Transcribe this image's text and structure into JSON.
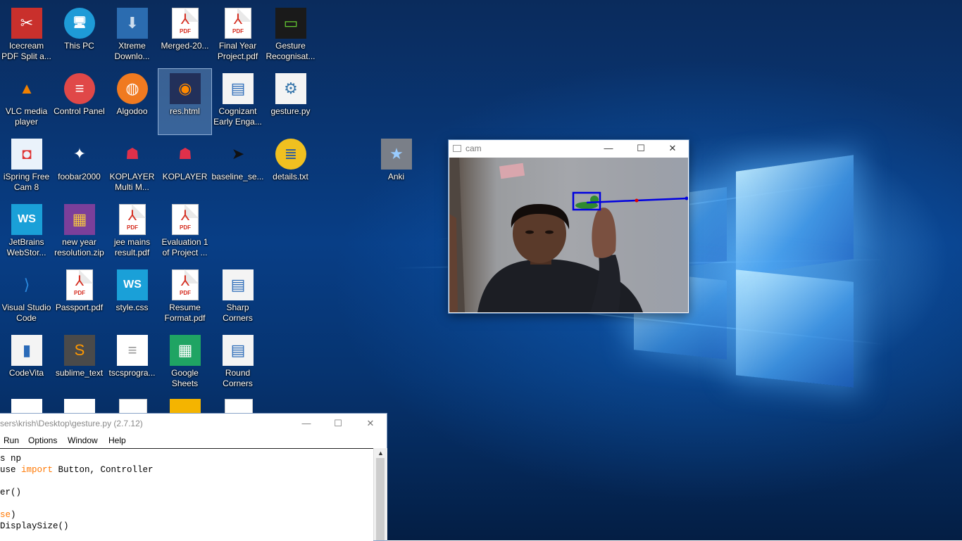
{
  "desktop": {
    "icons": [
      {
        "label": "Icecream PDF Split a...",
        "icon": "icecream-pdf-icon"
      },
      {
        "label": "This PC",
        "icon": "this-pc-icon"
      },
      {
        "label": "Xtreme Downlo...",
        "icon": "xtreme-download-icon"
      },
      {
        "label": "Merged-20...",
        "icon": "pdf-file-icon"
      },
      {
        "label": "Final Year Project.pdf",
        "icon": "pdf-file-icon"
      },
      {
        "label": "Gesture Recognisat...",
        "icon": "gesture-thumbnail-icon"
      },
      {
        "label": "VLC media player",
        "icon": "vlc-icon"
      },
      {
        "label": "Control Panel",
        "icon": "control-panel-icon"
      },
      {
        "label": "Algodoo",
        "icon": "algodoo-icon"
      },
      {
        "label": "res.html",
        "icon": "firefox-html-icon"
      },
      {
        "label": "Cognizant Early Enga...",
        "icon": "document-shortcut-icon"
      },
      {
        "label": "gesture.py",
        "icon": "python-file-icon"
      },
      {
        "label": "iSpring Free Cam 8",
        "icon": "ispring-cam-icon"
      },
      {
        "label": "foobar2000",
        "icon": "foobar-icon"
      },
      {
        "label": "KOPLAYER Multi M...",
        "icon": "koplayer-icon"
      },
      {
        "label": "KOPLAYER",
        "icon": "koplayer-icon"
      },
      {
        "label": "baseline_se...",
        "icon": "send-arrow-icon"
      },
      {
        "label": "details.txt",
        "icon": "text-file-icon"
      },
      {
        "label": "Anki",
        "icon": "anki-icon"
      },
      {
        "label": "JetBrains WebStor...",
        "icon": "webstorm-icon"
      },
      {
        "label": "new year resolution.zip",
        "icon": "winrar-icon"
      },
      {
        "label": "jee mains result.pdf",
        "icon": "pdf-file-icon"
      },
      {
        "label": "Evaluation 1 of Project ...",
        "icon": "pdf-file-icon"
      },
      {
        "label": "Visual Studio Code",
        "icon": "vscode-icon"
      },
      {
        "label": "Passport.pdf",
        "icon": "pdf-file-icon"
      },
      {
        "label": "style.css",
        "icon": "webstorm-icon"
      },
      {
        "label": "Resume Format.pdf",
        "icon": "pdf-file-icon"
      },
      {
        "label": "Sharp Corners",
        "icon": "document-shortcut-icon"
      },
      {
        "label": "CodeVita",
        "icon": "codevita-icon"
      },
      {
        "label": "sublime_text",
        "icon": "sublime-icon"
      },
      {
        "label": "tscsprogra...",
        "icon": "text-document-icon"
      },
      {
        "label": "Google Sheets",
        "icon": "google-sheets-icon"
      },
      {
        "label": "Round Corners",
        "icon": "document-shortcut-icon"
      }
    ]
  },
  "cam_window": {
    "title": "cam",
    "minimize": "—",
    "maximize": "☐",
    "close": "✕"
  },
  "idle_window": {
    "title": "sers\\krish\\Desktop\\gesture.py (2.7.12)",
    "menu": [
      "Run",
      "Options",
      "Window",
      "Help"
    ],
    "code_lines": [
      {
        "pre": "s np",
        "kw": "",
        "post": ""
      },
      {
        "pre": "use ",
        "kw": "import",
        "post": " Button, Controller"
      },
      {
        "pre": "",
        "kw": "",
        "post": ""
      },
      {
        "pre": "er()",
        "kw": "",
        "post": ""
      },
      {
        "pre": "",
        "kw": "",
        "post": ""
      },
      {
        "pre": "",
        "kw": "se",
        "post": ")"
      },
      {
        "pre": "DisplaySize()",
        "kw": "",
        "post": ""
      }
    ]
  },
  "colors": {
    "wallpaper_dark": "#06336f",
    "pdf_red": "#d52b1e",
    "python_keyword": "#ff7700",
    "tracking_line": "#0000e0"
  }
}
